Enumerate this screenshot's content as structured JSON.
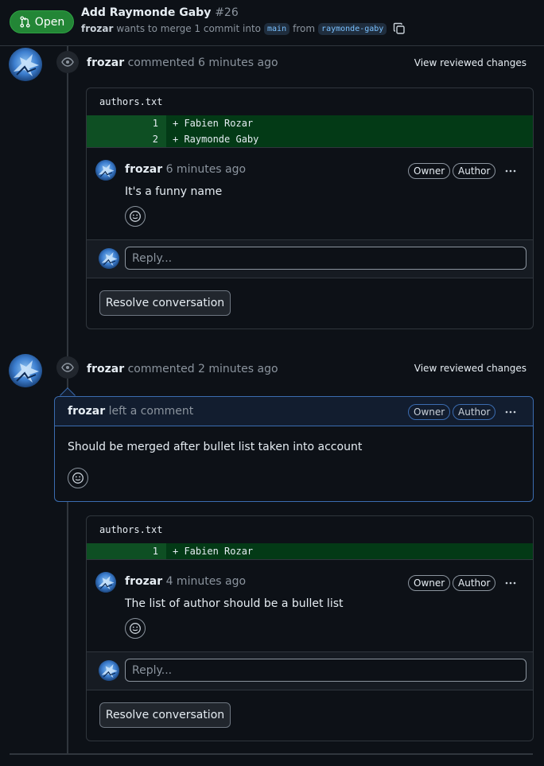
{
  "pr": {
    "state": "Open",
    "title": "Add Raymonde Gaby",
    "number": "#26",
    "author": "frozar",
    "merge_text": "wants to merge 1 commit into",
    "base_branch": "main",
    "from_text": "from",
    "head_branch": "raymonde-gaby"
  },
  "colors": {
    "open_green": "#238636",
    "accent_blue": "#3b6cb0",
    "diff_add": "#033a16"
  },
  "timeline": [
    {
      "author": "frozar",
      "action": "commented 6 minutes ago",
      "link": "View reviewed changes",
      "file": "authors.txt",
      "diff": [
        {
          "line": "1",
          "code": "+ Fabien Rozar"
        },
        {
          "line": "2",
          "code": "+ Raymonde Gaby"
        }
      ],
      "comment": {
        "author": "frozar",
        "time": "6 minutes ago",
        "badges": [
          "Owner",
          "Author"
        ],
        "body": "It's a funny name"
      },
      "reply_placeholder": "Reply...",
      "resolve_label": "Resolve conversation"
    },
    {
      "author": "frozar",
      "action": "commented 2 minutes ago",
      "link": "View reviewed changes",
      "review": {
        "author": "frozar",
        "action": "left a comment",
        "badges": [
          "Owner",
          "Author"
        ],
        "body": "Should be merged after bullet list taken into account"
      },
      "file": "authors.txt",
      "diff": [
        {
          "line": "1",
          "code": "+ Fabien Rozar"
        }
      ],
      "comment": {
        "author": "frozar",
        "time": "4 minutes ago",
        "badges": [
          "Owner",
          "Author"
        ],
        "body": "The list of author should be a bullet list"
      },
      "reply_placeholder": "Reply...",
      "resolve_label": "Resolve conversation"
    }
  ]
}
